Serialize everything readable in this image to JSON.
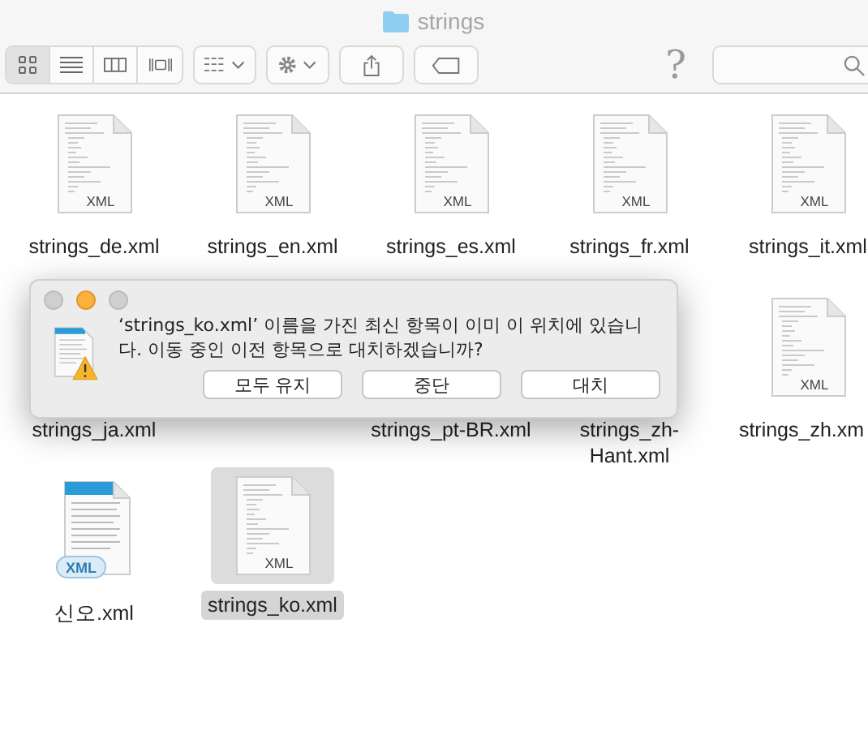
{
  "window": {
    "title": "strings"
  },
  "toolbar": {
    "views": [
      {
        "kind": "icons",
        "selected": true
      },
      {
        "kind": "list",
        "selected": false
      },
      {
        "kind": "columns",
        "selected": false
      },
      {
        "kind": "coverflow",
        "selected": false
      }
    ],
    "help": "?"
  },
  "rows": [
    [
      {
        "kind": "xml",
        "name": "strings_de.xml",
        "icon_label": "XML",
        "selected": false
      },
      {
        "kind": "xml",
        "name": "strings_en.xml",
        "icon_label": "XML",
        "selected": false
      },
      {
        "kind": "xml",
        "name": "strings_es.xml",
        "icon_label": "XML",
        "selected": false
      },
      {
        "kind": "xml",
        "name": "strings_fr.xml",
        "icon_label": "XML",
        "selected": false
      },
      {
        "kind": "xml",
        "name": "strings_it.xml",
        "icon_label": "XML",
        "selected": false
      }
    ],
    [
      {
        "kind": "covered",
        "name": "strings_ja.xml",
        "selected": false
      },
      {
        "kind": "hidden"
      },
      {
        "kind": "covered",
        "name": "strings_pt-BR.xml",
        "selected": false
      },
      {
        "kind": "covered",
        "name": "strings_zh-Hant.xml",
        "selected": false
      },
      {
        "kind": "xml",
        "name": "strings_zh.xm",
        "icon_label": "XML",
        "selected": false
      }
    ],
    [
      {
        "kind": "word-xml",
        "name": "신오.xml",
        "icon_label": "XML",
        "selected": false
      },
      {
        "kind": "xml",
        "name": "strings_ko.xml",
        "icon_label": "XML",
        "selected": true
      }
    ]
  ],
  "dialog": {
    "message": "‘strings_ko.xml’ 이름을 가진 최신 항목이 이미 이 위치에 있습니다. 이동 중인 이전 항목으로 대치하겠습니까?",
    "buttons": [
      "모두 유지",
      "중단",
      "대치"
    ]
  }
}
